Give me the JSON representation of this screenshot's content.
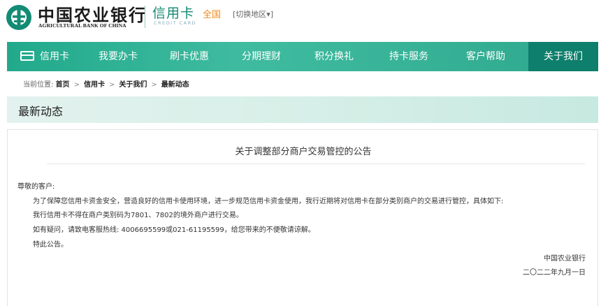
{
  "header": {
    "bank_name_cn": "中国农业银行",
    "bank_name_en": "AGRICULTURAL BANK OF CHINA",
    "product_cn": "信用卡",
    "product_en": "CREDIT CARD",
    "region": "全国",
    "region_switch": "[切换地区▾]",
    "brand_color": "#148b74",
    "region_color": "#f08a1c"
  },
  "nav": {
    "items": [
      {
        "label": "信用卡",
        "icon": "credit-card-icon"
      },
      {
        "label": "我要办卡"
      },
      {
        "label": "刷卡优惠"
      },
      {
        "label": "分期理财"
      },
      {
        "label": "积分换礼"
      },
      {
        "label": "持卡服务"
      },
      {
        "label": "客户帮助"
      },
      {
        "label": "关于我们"
      }
    ],
    "active": "关于我们",
    "bar_color": "#2eac90",
    "active_color": "#0d7f6c"
  },
  "breadcrumb": {
    "prefix": "当前位置:",
    "items": [
      "首页",
      "信用卡",
      "关于我们",
      "最新动态"
    ],
    "separator": ">"
  },
  "section": {
    "title": "最新动态"
  },
  "notice": {
    "title": "关于调整部分商户交易管控的公告",
    "greeting": "尊敬的客户:",
    "paragraphs": [
      "为了保障您信用卡资金安全，营造良好的信用卡使用环境，进一步规范信用卡资金使用，我行近期将对信用卡在部分类别商户的交易进行管控，具体如下:",
      "我行信用卡不得在商户类别码为7801、7802的境外商户进行交易。",
      "如有疑问，请致电客服热线: 4006695599或021-61195599，给您带来的不便敬请谅解。",
      "特此公告。"
    ],
    "signature": "中国农业银行",
    "date": "二〇二二年九月一日"
  }
}
